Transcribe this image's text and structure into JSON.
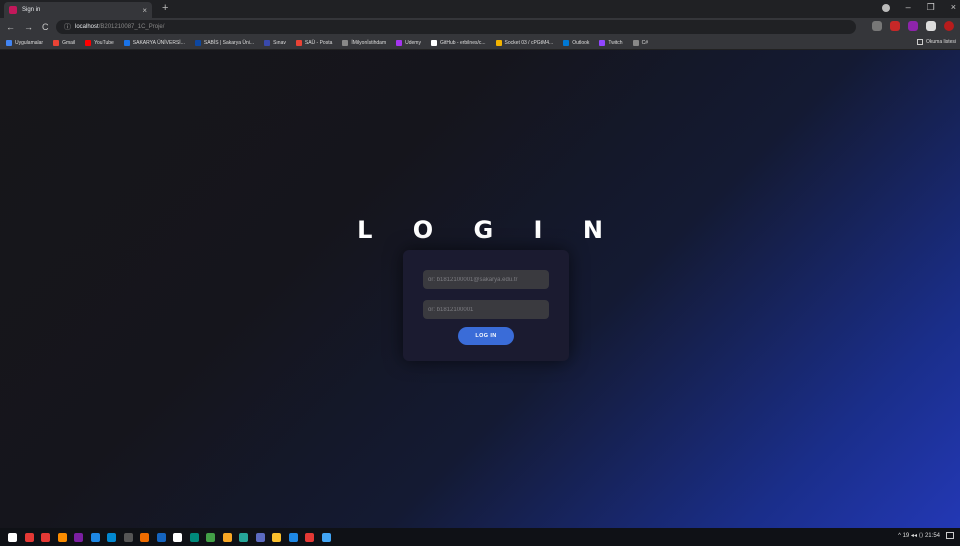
{
  "browser": {
    "tab": {
      "title": "Sign in",
      "close": "×"
    },
    "new_tab": "+",
    "window_controls": {
      "minimize": "–",
      "restore": "❐",
      "close": "×"
    },
    "nav": {
      "back": "←",
      "forward": "→",
      "reload": "C"
    },
    "address": {
      "info": "ⓘ",
      "host": "localhost",
      "path": "/B201210087_1C_Proje/"
    },
    "bookmarks": [
      {
        "label": "Uygulamalar",
        "color": "#4285f4"
      },
      {
        "label": "Gmail",
        "color": "#ea4335"
      },
      {
        "label": "YouTube",
        "color": "#ff0000"
      },
      {
        "label": "SAKARYA ÜNİVERSİ...",
        "color": "#1a73e8"
      },
      {
        "label": "SABİS | Sakarya Üni...",
        "color": "#0d47a1"
      },
      {
        "label": "Sınav",
        "color": "#3949ab"
      },
      {
        "label": "SAÜ - Posta",
        "color": "#ea4335"
      },
      {
        "label": "İMilyonİstihdam",
        "color": "#888888"
      },
      {
        "label": "Udemy",
        "color": "#a435f0"
      },
      {
        "label": "GitHub - erbilnes/c...",
        "color": "#ffffff"
      },
      {
        "label": "Socket 03 / cPGtM4...",
        "color": "#f4b400"
      },
      {
        "label": "Outlook",
        "color": "#0078d4"
      },
      {
        "label": "Twitch",
        "color": "#9146ff"
      },
      {
        "label": "C#",
        "color": "#888888"
      }
    ],
    "reading_list": "Okuma listesi"
  },
  "login": {
    "title": "L O G I N",
    "email_placeholder": "ör: b1812100001@sakarya.edu.tr",
    "password_placeholder": "ör: b1812100001",
    "button_label": "LOG IN"
  },
  "taskbar": {
    "icons": [
      "#1e88e5",
      "#e53935",
      "#e53935",
      "#fb8c00",
      "#7b1fa2",
      "#1e88e5",
      "#0288d1",
      "#555555",
      "#ef6c00",
      "#1565c0",
      "#ffffff",
      "#00897b",
      "#43a047",
      "#f9a825",
      "#26a69a",
      "#5c6bc0",
      "#fbc02d",
      "#1e88e5",
      "#e53935",
      "#42a5f5"
    ],
    "tray_text": "^ 19 ◂◂ ⟨⟩ 21:54"
  }
}
